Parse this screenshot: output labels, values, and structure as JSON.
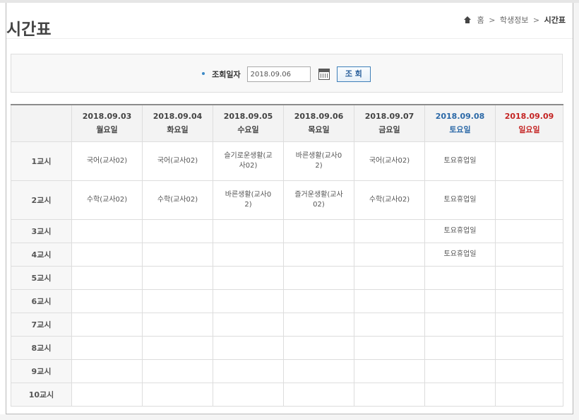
{
  "header": {
    "title": "시간표",
    "breadcrumb": {
      "home": "홈",
      "section": "학생정보",
      "current": "시간표",
      "separator": ">"
    }
  },
  "search": {
    "label": "조회일자",
    "date_value": "2018.09.06",
    "button_label": "조 회"
  },
  "timetable": {
    "days": [
      {
        "date": "2018.09.03",
        "name": "월요일",
        "color": "#444444"
      },
      {
        "date": "2018.09.04",
        "name": "화요일",
        "color": "#444444"
      },
      {
        "date": "2018.09.05",
        "name": "수요일",
        "color": "#444444"
      },
      {
        "date": "2018.09.06",
        "name": "목요일",
        "color": "#444444"
      },
      {
        "date": "2018.09.07",
        "name": "금요일",
        "color": "#444444"
      },
      {
        "date": "2018.09.08",
        "name": "토요일",
        "color": "#2c69a7"
      },
      {
        "date": "2018.09.09",
        "name": "일요일",
        "color": "#c42423"
      }
    ],
    "periods": [
      {
        "label": "1교시",
        "cells": [
          "국어(교사02)",
          "국어(교사02)",
          "슬기로운생활(교\n사02)",
          "바른생활(교사0\n2)",
          "국어(교사02)",
          "토요휴업일",
          ""
        ]
      },
      {
        "label": "2교시",
        "cells": [
          "수학(교사02)",
          "수학(교사02)",
          "바른생활(교사0\n2)",
          "즐거운생활(교사\n02)",
          "수학(교사02)",
          "토요휴업일",
          ""
        ]
      },
      {
        "label": "3교시",
        "cells": [
          "",
          "",
          "",
          "",
          "",
          "토요휴업일",
          ""
        ]
      },
      {
        "label": "4교시",
        "cells": [
          "",
          "",
          "",
          "",
          "",
          "토요휴업일",
          ""
        ]
      },
      {
        "label": "5교시",
        "cells": [
          "",
          "",
          "",
          "",
          "",
          "",
          ""
        ]
      },
      {
        "label": "6교시",
        "cells": [
          "",
          "",
          "",
          "",
          "",
          "",
          ""
        ]
      },
      {
        "label": "7교시",
        "cells": [
          "",
          "",
          "",
          "",
          "",
          "",
          ""
        ]
      },
      {
        "label": "8교시",
        "cells": [
          "",
          "",
          "",
          "",
          "",
          "",
          ""
        ]
      },
      {
        "label": "9교시",
        "cells": [
          "",
          "",
          "",
          "",
          "",
          "",
          ""
        ]
      },
      {
        "label": "10교시",
        "cells": [
          "",
          "",
          "",
          "",
          "",
          "",
          ""
        ]
      }
    ]
  },
  "icons": {
    "home": "home-icon",
    "calendar": "calendar-icon",
    "bullet": "bullet-icon"
  }
}
